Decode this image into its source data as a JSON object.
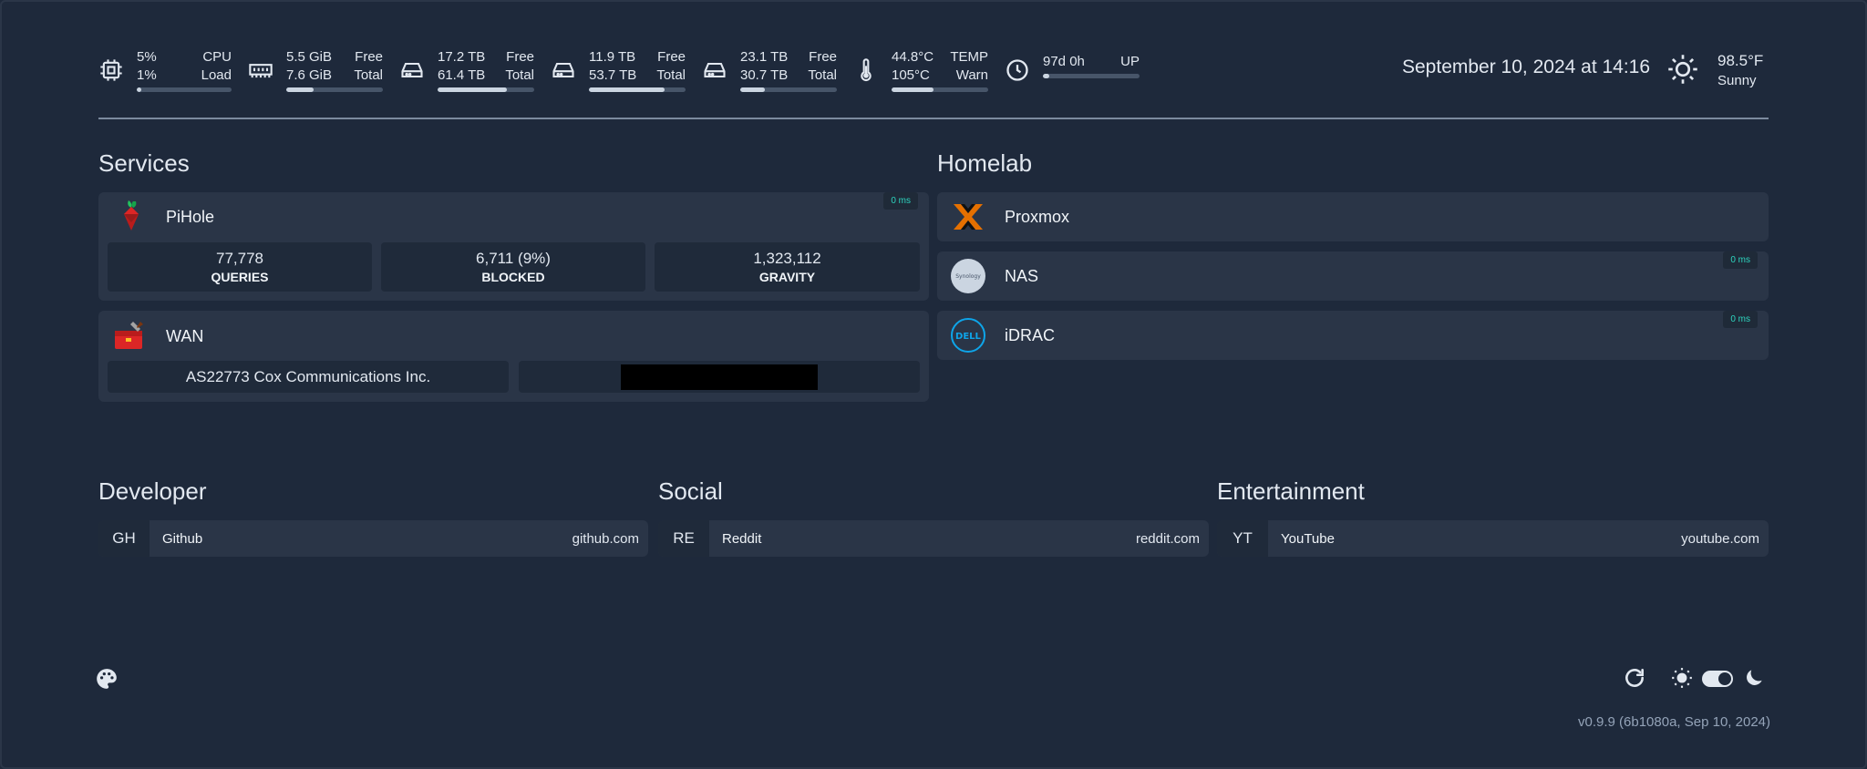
{
  "stats": {
    "cpu": {
      "v1": "5%",
      "v2": "1%",
      "l1": "CPU",
      "l2": "Load",
      "pct": 5
    },
    "ram": {
      "v1": "5.5 GiB",
      "v2": "7.6 GiB",
      "l1": "Free",
      "l2": "Total",
      "pct": 28
    },
    "disk1": {
      "v1": "17.2 TB",
      "v2": "61.4 TB",
      "l1": "Free",
      "l2": "Total",
      "pct": 72
    },
    "disk2": {
      "v1": "11.9 TB",
      "v2": "53.7 TB",
      "l1": "Free",
      "l2": "Total",
      "pct": 78
    },
    "disk3": {
      "v1": "23.1 TB",
      "v2": "30.7 TB",
      "l1": "Free",
      "l2": "Total",
      "pct": 25
    },
    "temp": {
      "v1": "44.8°C",
      "v2": "105°C",
      "l1": "TEMP",
      "l2": "Warn",
      "pct": 43
    },
    "uptime": {
      "v1": "97d 0h",
      "l1": "UP",
      "pct": 7
    }
  },
  "datetime": "September 10, 2024 at 14:16",
  "weather": {
    "temp": "98.5°F",
    "condition": "Sunny"
  },
  "sections": {
    "services": "Services",
    "homelab": "Homelab",
    "developer": "Developer",
    "social": "Social",
    "entertainment": "Entertainment"
  },
  "services": {
    "pihole": {
      "name": "PiHole",
      "ping": "0 ms",
      "stats": [
        {
          "value": "77,778",
          "label": "QUERIES"
        },
        {
          "value": "6,711 (9%)",
          "label": "BLOCKED"
        },
        {
          "value": "1,323,112",
          "label": "GRAVITY"
        }
      ]
    },
    "wan": {
      "name": "WAN",
      "isp": "AS22773 Cox Communications Inc."
    }
  },
  "homelab": [
    {
      "name": "Proxmox",
      "ping": ""
    },
    {
      "name": "NAS",
      "ping": "0 ms"
    },
    {
      "name": "iDRAC",
      "ping": "0 ms"
    }
  ],
  "bookmarks": {
    "developer": {
      "abbr": "GH",
      "name": "Github",
      "url": "github.com"
    },
    "social": {
      "abbr": "RE",
      "name": "Reddit",
      "url": "reddit.com"
    },
    "entertainment": {
      "abbr": "YT",
      "name": "YouTube",
      "url": "youtube.com"
    }
  },
  "nas_logo_text": "Synology",
  "idrac_logo_text": "DELL",
  "version": "v0.9.9 (6b1080a, Sep 10, 2024)"
}
